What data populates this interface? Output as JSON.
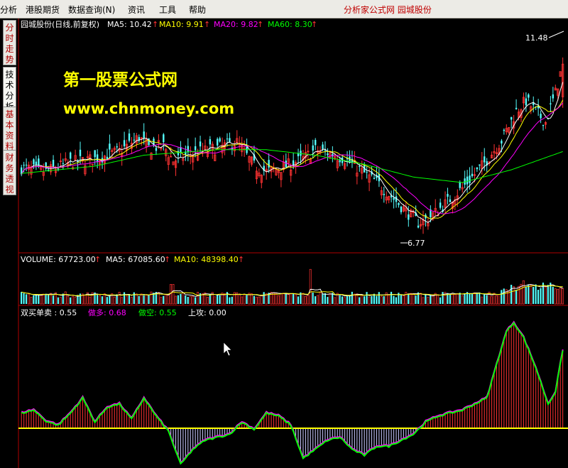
{
  "menu": {
    "items": [
      {
        "label": "分析"
      },
      {
        "label": "港股期货"
      },
      {
        "label": "数据查询(N)"
      },
      {
        "label": "资讯"
      },
      {
        "label": "工具"
      },
      {
        "label": "帮助"
      }
    ],
    "right_title": "分析家公式网  园城股份"
  },
  "side_tabs": [
    {
      "label": "分时走势"
    },
    {
      "label": "技术分析"
    },
    {
      "label": "基本资料"
    },
    {
      "label": "财务透视"
    }
  ],
  "price_panel": {
    "title": "园城股份(日线,前复权)",
    "ma": [
      {
        "label": "MA5: 10.42",
        "color": "#ffffff"
      },
      {
        "label": "MA10: 9.91",
        "color": "#ffff00"
      },
      {
        "label": "MA20: 9.82",
        "color": "#ff00ff"
      },
      {
        "label": "MA60: 8.30",
        "color": "#00ff00"
      }
    ],
    "high_label": "11.48",
    "low_label": "6.77"
  },
  "watermark": {
    "line1": "第一股票公式网",
    "line2": "www.chnmoney.com",
    "color": "#ffff00"
  },
  "volume_panel": {
    "items": [
      {
        "label": "VOLUME: 67723.00",
        "color": "#ffffff"
      },
      {
        "label": "MA5: 67085.60",
        "color": "#ffffff"
      },
      {
        "label": "MA10: 48398.40",
        "color": "#ffff00"
      }
    ]
  },
  "indicator_panel": {
    "items": [
      {
        "label": "双买单卖 : 0.55",
        "color": "#ffffff"
      },
      {
        "label": "做多: 0.68",
        "color": "#ff00ff"
      },
      {
        "label": "做空: 0.55",
        "color": "#00ff00"
      },
      {
        "label": "上攻: 0.00",
        "color": "#ffffff"
      }
    ]
  },
  "colors": {
    "up": "#ff3232",
    "down": "#54fcfc",
    "ma5": "#ffffff",
    "ma10": "#ffff00",
    "ma20": "#ff00ff",
    "ma60": "#00ff00",
    "frame": "#b00000"
  },
  "chart_data": {
    "type": "candlestick",
    "series_anchors": {
      "close": [
        [
          0,
          8.45
        ],
        [
          10,
          8.35
        ],
        [
          20,
          8.6
        ],
        [
          30,
          8.7
        ],
        [
          40,
          8.9
        ],
        [
          48,
          9.3
        ],
        [
          52,
          9.0
        ],
        [
          58,
          9.05
        ],
        [
          62,
          8.65
        ],
        [
          70,
          8.85
        ],
        [
          80,
          9.0
        ],
        [
          88,
          9.15
        ],
        [
          95,
          8.5
        ],
        [
          100,
          8.35
        ],
        [
          108,
          8.5
        ],
        [
          115,
          8.7
        ],
        [
          120,
          8.95
        ],
        [
          126,
          8.85
        ],
        [
          132,
          8.7
        ],
        [
          138,
          8.4
        ],
        [
          146,
          8.0
        ],
        [
          152,
          7.6
        ],
        [
          158,
          7.2
        ],
        [
          162,
          6.95
        ],
        [
          166,
          7.05
        ],
        [
          172,
          7.4
        ],
        [
          180,
          7.9
        ],
        [
          188,
          8.5
        ],
        [
          196,
          9.2
        ],
        [
          202,
          10.0
        ],
        [
          206,
          10.3
        ],
        [
          210,
          10.0
        ],
        [
          214,
          9.7
        ],
        [
          218,
          10.5
        ],
        [
          221,
          11.3
        ]
      ],
      "ma60": [
        [
          0,
          8.3
        ],
        [
          30,
          8.5
        ],
        [
          50,
          8.8
        ],
        [
          80,
          8.95
        ],
        [
          100,
          8.95
        ],
        [
          120,
          8.8
        ],
        [
          140,
          8.55
        ],
        [
          160,
          8.2
        ],
        [
          180,
          8.05
        ],
        [
          200,
          8.4
        ],
        [
          221,
          8.9
        ]
      ],
      "indicator": [
        [
          0,
          0.25
        ],
        [
          5,
          0.3
        ],
        [
          10,
          0.12
        ],
        [
          15,
          0.05
        ],
        [
          20,
          0.25
        ],
        [
          25,
          0.5
        ],
        [
          30,
          0.1
        ],
        [
          35,
          0.35
        ],
        [
          40,
          0.4
        ],
        [
          45,
          0.15
        ],
        [
          50,
          0.5
        ],
        [
          55,
          0.2
        ],
        [
          60,
          -0.05
        ],
        [
          65,
          -0.6
        ],
        [
          70,
          -0.35
        ],
        [
          75,
          -0.2
        ],
        [
          80,
          -0.15
        ],
        [
          85,
          -0.1
        ],
        [
          90,
          0.1
        ],
        [
          95,
          -0.02
        ],
        [
          100,
          0.25
        ],
        [
          105,
          0.2
        ],
        [
          110,
          0.05
        ],
        [
          115,
          -0.5
        ],
        [
          120,
          -0.35
        ],
        [
          125,
          -0.2
        ],
        [
          130,
          -0.15
        ],
        [
          135,
          -0.35
        ],
        [
          140,
          -0.45
        ],
        [
          145,
          -0.3
        ],
        [
          150,
          -0.3
        ],
        [
          155,
          -0.2
        ],
        [
          160,
          -0.1
        ],
        [
          165,
          0.1
        ],
        [
          170,
          0.2
        ],
        [
          175,
          0.25
        ],
        [
          180,
          0.3
        ],
        [
          185,
          0.4
        ],
        [
          190,
          0.5
        ],
        [
          195,
          1.2
        ],
        [
          198,
          1.6
        ],
        [
          201,
          1.75
        ],
        [
          205,
          1.5
        ],
        [
          210,
          1.0
        ],
        [
          215,
          0.4
        ],
        [
          218,
          0.6
        ],
        [
          221,
          1.3
        ]
      ]
    },
    "high": 11.48,
    "low": 6.77,
    "volume_ma5": 67085.6,
    "volume_ma10": 48398.4,
    "volume_last": 67723.0
  }
}
